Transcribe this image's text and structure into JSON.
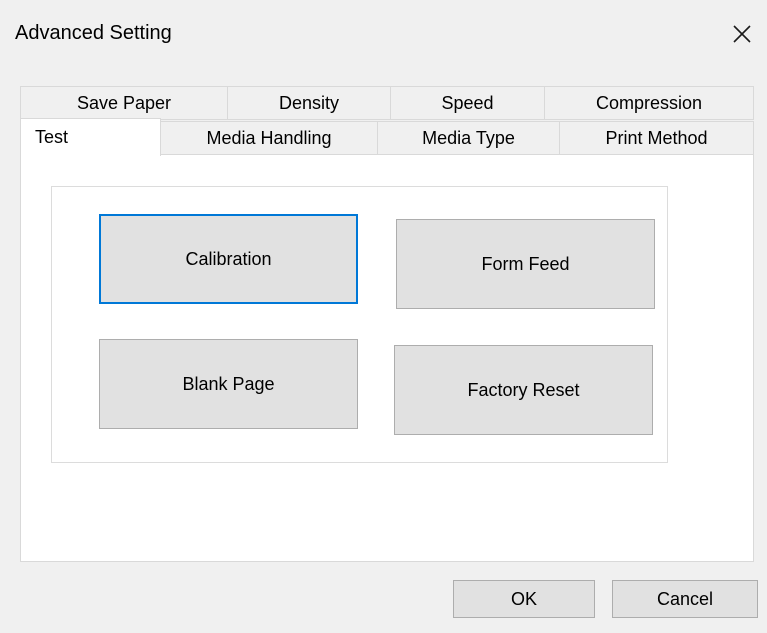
{
  "window": {
    "title": "Advanced Setting",
    "close_icon": "close-icon"
  },
  "tabs": {
    "row_top": [
      {
        "label": "Save Paper"
      },
      {
        "label": "Density"
      },
      {
        "label": "Speed"
      },
      {
        "label": "Compression"
      }
    ],
    "row_bottom": [
      {
        "label": "Test",
        "selected": true
      },
      {
        "label": "Media Handling"
      },
      {
        "label": "Media Type"
      },
      {
        "label": "Print Method"
      }
    ]
  },
  "test_panel": {
    "buttons": [
      {
        "label": "Calibration",
        "focused": true
      },
      {
        "label": "Form Feed"
      },
      {
        "label": "Blank Page"
      },
      {
        "label": "Factory Reset"
      }
    ]
  },
  "footer": {
    "ok_label": "OK",
    "cancel_label": "Cancel"
  },
  "colors": {
    "focus_border": "#0078d7",
    "button_face": "#e1e1e1",
    "dialog_bg": "#f0f0f0"
  }
}
